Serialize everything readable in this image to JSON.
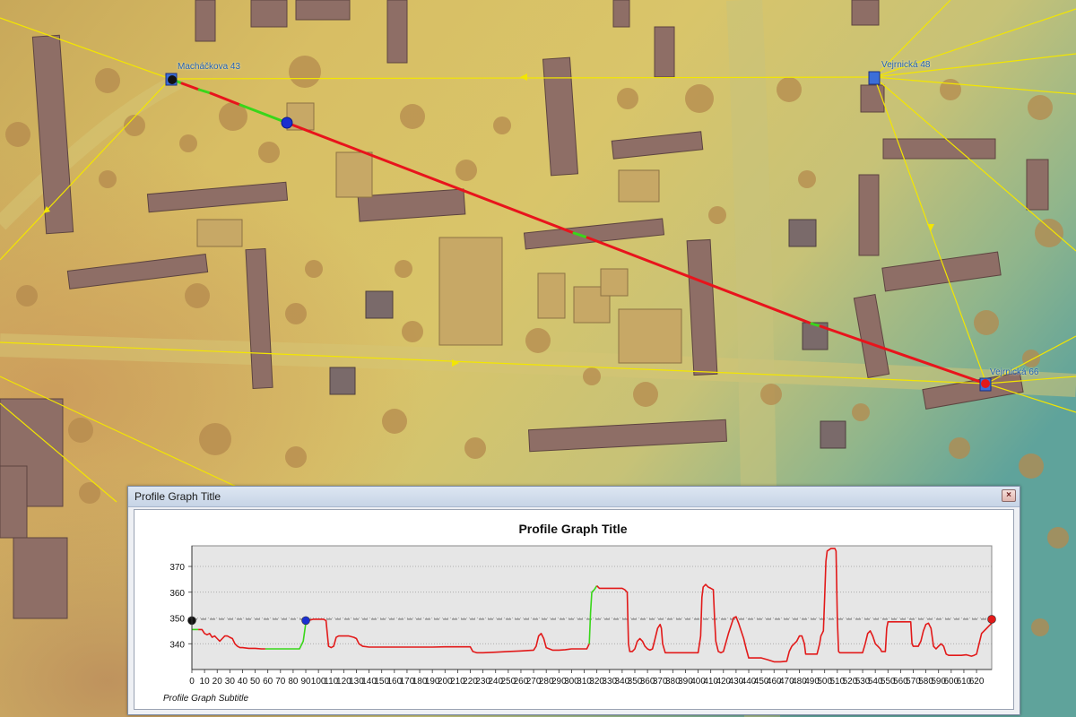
{
  "window": {
    "title": "Profile Graph Title",
    "close_glyph": "×"
  },
  "map": {
    "labels": [
      {
        "id": "a",
        "text": "Macháčkova 43"
      },
      {
        "id": "b",
        "text": "Vejrnická 48"
      },
      {
        "id": "c",
        "text": "Vejrnická 66"
      }
    ],
    "colors": {
      "sight_line_visible": "#39d61a",
      "sight_line_blocked": "#e8141c",
      "network_line": "#f3e600",
      "observer": "#0a1a8c",
      "start_point": "#111111",
      "end_point": "#e21a1a"
    }
  },
  "chart_data": {
    "type": "line",
    "title": "Profile Graph Title",
    "subtitle": "Profile Graph Subtitle",
    "xlabel": "",
    "ylabel": "",
    "xlim": [
      0,
      632
    ],
    "ylim": [
      330,
      378
    ],
    "x_ticks": [
      0,
      10,
      20,
      30,
      40,
      50,
      60,
      70,
      80,
      90,
      100,
      110,
      120,
      130,
      140,
      150,
      160,
      170,
      180,
      190,
      200,
      210,
      220,
      230,
      240,
      250,
      260,
      270,
      280,
      290,
      300,
      310,
      320,
      330,
      340,
      350,
      360,
      370,
      380,
      390,
      400,
      410,
      420,
      430,
      440,
      450,
      460,
      470,
      480,
      490,
      500,
      510,
      520,
      530,
      540,
      550,
      560,
      570,
      580,
      590,
      600,
      610,
      620
    ],
    "y_ticks": [
      340,
      350,
      360,
      370
    ],
    "grid": true,
    "reference_line": 349.5,
    "markers": [
      {
        "name": "start",
        "x": 0,
        "y": 349,
        "color": "#111111"
      },
      {
        "name": "observer",
        "x": 90,
        "y": 349,
        "color": "#1a2fd0"
      },
      {
        "name": "target",
        "x": 632,
        "y": 349.5,
        "color": "#e21a1a"
      }
    ],
    "series": [
      {
        "visibility": "visible",
        "color": "#39d61a",
        "points": [
          [
            0,
            345.5
          ],
          [
            5,
            345.5
          ]
        ]
      },
      {
        "visibility": "blocked",
        "color": "#e21a1a",
        "points": [
          [
            5,
            345.5
          ],
          [
            8,
            345.5
          ],
          [
            10,
            344
          ],
          [
            12,
            343.5
          ],
          [
            14,
            344
          ],
          [
            16,
            342.5
          ],
          [
            18,
            343
          ],
          [
            20,
            342
          ],
          [
            22,
            341
          ],
          [
            24,
            342
          ],
          [
            26,
            343
          ],
          [
            28,
            343
          ],
          [
            30,
            342.5
          ],
          [
            32,
            342
          ],
          [
            34,
            340
          ],
          [
            36,
            339
          ],
          [
            38,
            338.5
          ],
          [
            40,
            338.5
          ],
          [
            45,
            338.2
          ],
          [
            50,
            338.2
          ],
          [
            55,
            338
          ],
          [
            58,
            338
          ]
        ]
      },
      {
        "visibility": "visible",
        "color": "#39d61a",
        "points": [
          [
            58,
            338
          ],
          [
            65,
            338
          ],
          [
            70,
            338
          ],
          [
            75,
            338
          ],
          [
            80,
            338
          ],
          [
            85,
            338
          ],
          [
            88,
            341
          ],
          [
            90,
            348
          ]
        ]
      },
      {
        "visibility": "blocked",
        "color": "#e21a1a",
        "points": [
          [
            90,
            348
          ],
          [
            92,
            349
          ],
          [
            96,
            349.5
          ],
          [
            100,
            349.5
          ],
          [
            104,
            349.5
          ],
          [
            106,
            349
          ],
          [
            107,
            344
          ],
          [
            108,
            339
          ],
          [
            110,
            338.5
          ],
          [
            112,
            339
          ],
          [
            114,
            342.5
          ],
          [
            116,
            343
          ],
          [
            120,
            343
          ],
          [
            124,
            343
          ],
          [
            128,
            342.5
          ],
          [
            130,
            342
          ],
          [
            132,
            340
          ],
          [
            135,
            339
          ],
          [
            140,
            338.7
          ],
          [
            150,
            338.7
          ],
          [
            160,
            338.7
          ],
          [
            170,
            338.7
          ],
          [
            180,
            338.7
          ],
          [
            190,
            338.7
          ],
          [
            200,
            338.8
          ],
          [
            210,
            338.8
          ],
          [
            220,
            338.8
          ],
          [
            222,
            337
          ],
          [
            225,
            336.5
          ],
          [
            230,
            336.5
          ],
          [
            240,
            336.7
          ],
          [
            250,
            337
          ],
          [
            260,
            337.2
          ],
          [
            270,
            337.5
          ],
          [
            272,
            339
          ],
          [
            274,
            343
          ],
          [
            276,
            344
          ],
          [
            278,
            342
          ],
          [
            280,
            338.5
          ],
          [
            285,
            337.5
          ],
          [
            290,
            337.5
          ],
          [
            295,
            337.7
          ],
          [
            300,
            338
          ],
          [
            305,
            338
          ],
          [
            310,
            338
          ],
          [
            312,
            338
          ],
          [
            314,
            340
          ]
        ]
      },
      {
        "visibility": "visible",
        "color": "#39d61a",
        "points": [
          [
            314,
            340
          ],
          [
            315,
            352
          ],
          [
            316,
            360
          ],
          [
            318,
            361
          ],
          [
            320,
            362.5
          ]
        ]
      },
      {
        "visibility": "blocked",
        "color": "#e21a1a",
        "points": [
          [
            320,
            362.5
          ],
          [
            322,
            361.5
          ],
          [
            330,
            361.5
          ],
          [
            338,
            361.5
          ],
          [
            340,
            361.5
          ],
          [
            342,
            361
          ],
          [
            344,
            360
          ],
          [
            345,
            340
          ],
          [
            346,
            337
          ],
          [
            348,
            337
          ],
          [
            350,
            338
          ],
          [
            352,
            341
          ],
          [
            354,
            342
          ],
          [
            356,
            341
          ],
          [
            358,
            339
          ],
          [
            360,
            338
          ],
          [
            362,
            337.5
          ],
          [
            364,
            338
          ],
          [
            366,
            342
          ],
          [
            368,
            346
          ],
          [
            370,
            347.5
          ],
          [
            371,
            346
          ],
          [
            372,
            340
          ],
          [
            374,
            336.5
          ],
          [
            380,
            336.5
          ],
          [
            390,
            336.5
          ],
          [
            400,
            336.5
          ],
          [
            402,
            343
          ],
          [
            403,
            358
          ],
          [
            404,
            362
          ],
          [
            406,
            363
          ],
          [
            408,
            362
          ],
          [
            410,
            361.5
          ],
          [
            412,
            361
          ],
          [
            413,
            350
          ],
          [
            414,
            341
          ],
          [
            416,
            337
          ],
          [
            418,
            336.5
          ],
          [
            420,
            337
          ],
          [
            424,
            344
          ],
          [
            428,
            350
          ],
          [
            430,
            350.5
          ],
          [
            432,
            348
          ],
          [
            436,
            342
          ],
          [
            438,
            338
          ],
          [
            440,
            334.5
          ],
          [
            444,
            334.5
          ],
          [
            450,
            334.5
          ],
          [
            455,
            333.8
          ],
          [
            460,
            333
          ],
          [
            465,
            333
          ],
          [
            470,
            333.2
          ],
          [
            472,
            337
          ],
          [
            474,
            339
          ],
          [
            478,
            341
          ],
          [
            480,
            343
          ],
          [
            482,
            343
          ],
          [
            484,
            340
          ],
          [
            485,
            336
          ],
          [
            490,
            336
          ],
          [
            494,
            336
          ],
          [
            496,
            340
          ],
          [
            497,
            343
          ],
          [
            498,
            344
          ],
          [
            499,
            345
          ],
          [
            500,
            358
          ],
          [
            501,
            372
          ],
          [
            502,
            376
          ],
          [
            505,
            377
          ],
          [
            508,
            377
          ],
          [
            509,
            376
          ],
          [
            510,
            350
          ],
          [
            511,
            337
          ],
          [
            512,
            336.5
          ],
          [
            520,
            336.5
          ],
          [
            530,
            336.5
          ],
          [
            532,
            340
          ],
          [
            534,
            344
          ],
          [
            536,
            345
          ],
          [
            538,
            343
          ],
          [
            540,
            340
          ],
          [
            542,
            339
          ],
          [
            544,
            338
          ],
          [
            545,
            337
          ],
          [
            548,
            337
          ],
          [
            549,
            346
          ],
          [
            550,
            348.5
          ],
          [
            555,
            348.5
          ],
          [
            560,
            348.5
          ],
          [
            565,
            348.5
          ],
          [
            568,
            348.5
          ],
          [
            569,
            340
          ],
          [
            570,
            339
          ],
          [
            574,
            339
          ],
          [
            576,
            341
          ],
          [
            578,
            345
          ],
          [
            580,
            347.5
          ],
          [
            582,
            348
          ],
          [
            584,
            346
          ],
          [
            586,
            339
          ],
          [
            588,
            338
          ],
          [
            590,
            339
          ],
          [
            592,
            340
          ],
          [
            594,
            339
          ],
          [
            596,
            336
          ],
          [
            598,
            335.5
          ],
          [
            600,
            335.5
          ],
          [
            604,
            335.5
          ],
          [
            608,
            335.5
          ],
          [
            612,
            335.7
          ],
          [
            616,
            335.2
          ],
          [
            618,
            335.5
          ],
          [
            620,
            336
          ],
          [
            622,
            340
          ],
          [
            624,
            344
          ],
          [
            626,
            345
          ],
          [
            628,
            346
          ],
          [
            630,
            347
          ],
          [
            632,
            348
          ]
        ]
      }
    ]
  }
}
